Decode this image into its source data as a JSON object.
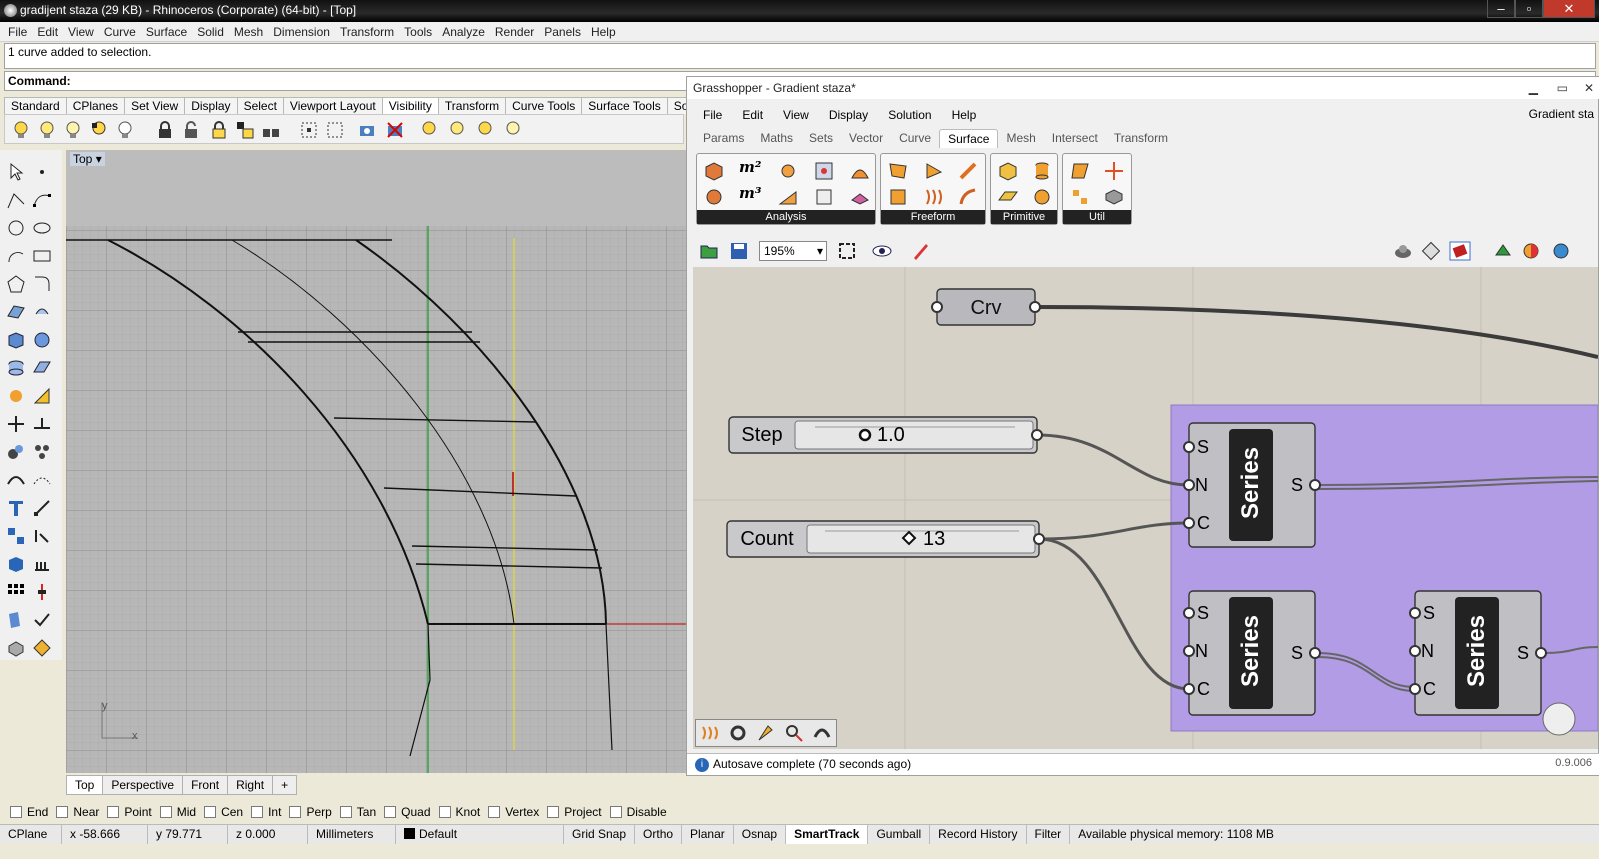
{
  "rhino": {
    "title": "gradijent staza (29 KB) - Rhinoceros (Corporate) (64-bit) - [Top]",
    "menu": [
      "File",
      "Edit",
      "View",
      "Curve",
      "Surface",
      "Solid",
      "Mesh",
      "Dimension",
      "Transform",
      "Tools",
      "Analyze",
      "Render",
      "Panels",
      "Help"
    ],
    "command_history": "1 curve added to selection.",
    "command_prompt": "Command:",
    "toolbar_tabs": [
      "Standard",
      "CPlanes",
      "Set View",
      "Display",
      "Select",
      "Viewport Layout",
      "Visibility",
      "Transform",
      "Curve Tools",
      "Surface Tools",
      "Solid"
    ],
    "active_tab": "Visibility",
    "viewport_label": "Top",
    "axis_y": "y",
    "axis_x": "x",
    "viewport_tabs": [
      "Top",
      "Perspective",
      "Front",
      "Right"
    ],
    "add_tab": "+",
    "osnaps": [
      "End",
      "Near",
      "Point",
      "Mid",
      "Cen",
      "Int",
      "Perp",
      "Tan",
      "Quad",
      "Knot",
      "Vertex",
      "Project",
      "Disable"
    ],
    "status": {
      "cplane": "CPlane",
      "x": "x -58.666",
      "y": "y 79.771",
      "z": "z 0.000",
      "units": "Millimeters",
      "layer": "Default",
      "grid_snap": "Grid Snap",
      "ortho": "Ortho",
      "planar": "Planar",
      "osnap": "Osnap",
      "smarttrack": "SmartTrack",
      "gumball": "Gumball",
      "record_history": "Record History",
      "filter": "Filter",
      "memory": "Available physical memory: 1108 MB"
    }
  },
  "grasshopper": {
    "title": "Grasshopper - Gradient staza*",
    "menu": [
      "File",
      "Edit",
      "View",
      "Display",
      "Solution",
      "Help"
    ],
    "doc_name": "Gradient sta",
    "tabs": [
      "Params",
      "Maths",
      "Sets",
      "Vector",
      "Curve",
      "Surface",
      "Mesh",
      "Intersect",
      "Transform"
    ],
    "active_tab": "Surface",
    "groups": [
      "Analysis",
      "Freeform",
      "Primitive",
      "Util"
    ],
    "m2": "m²",
    "m3": "m³",
    "zoom": "195%",
    "nodes": {
      "crv": "Crv",
      "step_label": "Step",
      "step_value": "1.0",
      "count_label": "Count",
      "count_value": "13",
      "series": "Series",
      "in_s": "S",
      "in_n": "N",
      "in_c": "C",
      "out_s": "S"
    },
    "status": "Autosave complete (70 seconds ago)",
    "version": "0.9.006"
  },
  "colors": {
    "group_fill": "#b39ce6",
    "canvas": "#d6d2c7",
    "viewport": "#b9b9b9"
  }
}
